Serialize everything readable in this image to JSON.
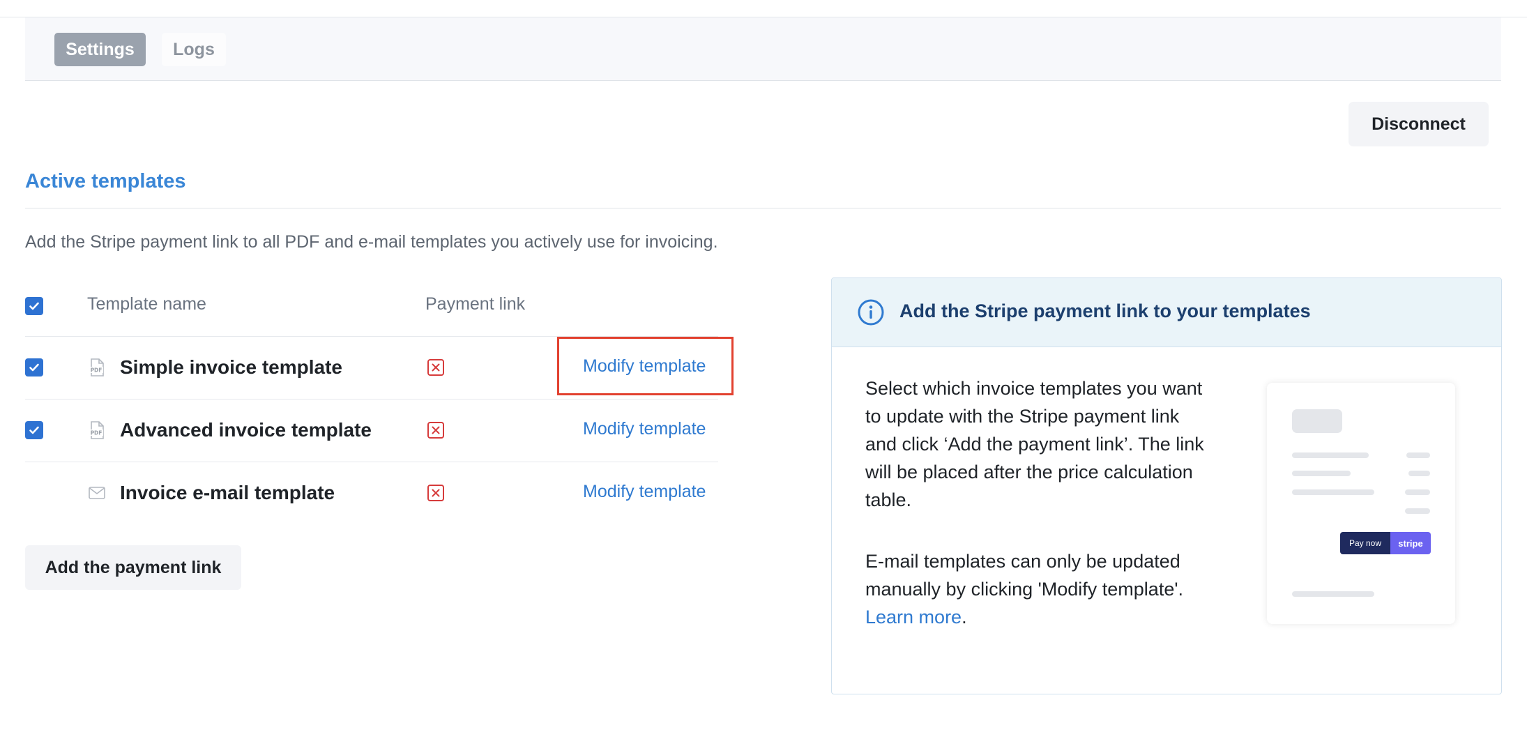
{
  "tabs": {
    "settings": "Settings",
    "logs": "Logs"
  },
  "header": {
    "disconnect_label": "Disconnect"
  },
  "section": {
    "title": "Active templates",
    "description": "Add the Stripe payment link to all PDF and e-mail templates you actively use for invoicing."
  },
  "table": {
    "columns": {
      "name": "Template name",
      "payment_link": "Payment link"
    },
    "rows": [
      {
        "name": "Simple invoice template",
        "type": "pdf",
        "checked": true,
        "payment_link": "missing",
        "action": "Modify template"
      },
      {
        "name": "Advanced invoice template",
        "type": "pdf",
        "checked": true,
        "payment_link": "missing",
        "action": "Modify template"
      },
      {
        "name": "Invoice e-mail template",
        "type": "email",
        "checked": false,
        "payment_link": "missing",
        "action": "Modify template"
      }
    ]
  },
  "actions": {
    "add_payment_link": "Add the payment link"
  },
  "info_panel": {
    "title": "Add the Stripe payment link to your templates",
    "paragraph1": "Select which invoice templates you want to update with the Stripe payment link and click ‘Add the payment link’. The link will be placed after the price calculation table.",
    "paragraph2": "E-mail templates can only be updated manually by clicking 'Modify template'.",
    "learn_more": "Learn more",
    "learn_more_suffix": ".",
    "preview": {
      "pay_now": "Pay now",
      "brand": "stripe"
    }
  },
  "colors": {
    "accent": "#3a86d6",
    "checkbox": "#2e72d2",
    "link": "#2f7ad0",
    "error": "#d63b3b",
    "highlight": "#e2412f",
    "panel_header_bg": "#eaf4f9",
    "panel_title": "#1c3f6e",
    "stripe_purple": "#6b62f0",
    "stripe_navy": "#1f2a5e"
  },
  "icons": {
    "pdf": "pdf-file-icon",
    "email": "envelope-icon",
    "missing": "x-square-icon",
    "info": "info-circle-icon",
    "check": "checkmark-icon"
  }
}
